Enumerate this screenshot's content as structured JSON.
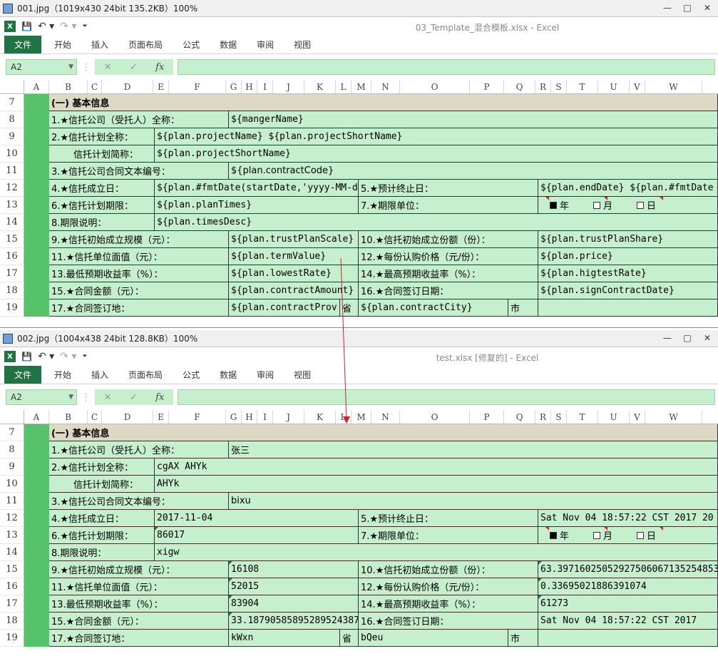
{
  "win1": {
    "viewer_title": "001.jpg（1019x430  24bit  135.2KB）100%",
    "doc_title": "03_Template_混合模板.xlsx - Excel",
    "rows": [
      {
        "rn": "7",
        "cells": [
          {
            "t": "(一) 基本信息",
            "w": 938,
            "k": "head"
          }
        ]
      },
      {
        "rn": "8",
        "cells": [
          {
            "t": "1.★信托公司（受托人）全称：",
            "w": 252,
            "k": "cn"
          },
          {
            "t": "${mangerName}",
            "w": 686
          }
        ]
      },
      {
        "rn": "9",
        "cells": [
          {
            "t": "2.★信托计划全称：",
            "w": 148,
            "k": "cn"
          },
          {
            "t": "${plan.projectName} ${plan.projectShortName}",
            "w": 790
          }
        ]
      },
      {
        "rn": "10",
        "cells": [
          {
            "t": "信托计划简称：",
            "w": 148,
            "k": "cn indent"
          },
          {
            "t": "${plan.projectShortName}",
            "w": 790
          }
        ]
      },
      {
        "rn": "11",
        "cells": [
          {
            "t": "3.★信托公司合同文本编号：",
            "w": 252,
            "k": "cn"
          },
          {
            "t": "${plan.contractCode}",
            "w": 686,
            "k": "cn"
          }
        ]
      },
      {
        "rn": "12",
        "cells": [
          {
            "t": "4.★信托成立日：",
            "w": 148,
            "k": "cn"
          },
          {
            "t": "${plan.#fmtDate(startDate,'yyyy-MM-dd')}",
            "w": 286
          },
          {
            "t": "5.★预计终止日：",
            "w": 252,
            "k": "cn"
          },
          {
            "t": "${plan.endDate} ${plan.#fmtDate",
            "w": 252
          }
        ]
      },
      {
        "rn": "13",
        "cells": [
          {
            "t": "6.★信托计划期限：",
            "w": 148,
            "k": "cn"
          },
          {
            "t": "${plan.planTimes}",
            "w": 286
          },
          {
            "t": "7.★期限单位：",
            "w": 252,
            "k": "cn"
          },
          {
            "t": "",
            "w": 252,
            "k": "units"
          }
        ]
      },
      {
        "rn": "14",
        "cells": [
          {
            "t": "8.期限说明：",
            "w": 148,
            "k": "cn"
          },
          {
            "t": "${plan.timesDesc}",
            "w": 790
          }
        ]
      },
      {
        "rn": "15",
        "cells": [
          {
            "t": "9.★信托初始成立规模（元）：",
            "w": 252,
            "k": "cn"
          },
          {
            "t": "${plan.trustPlanScale}",
            "w": 182
          },
          {
            "t": "10.★信托初始成立份额（份）：",
            "w": 252,
            "k": "cn"
          },
          {
            "t": "${plan.trustPlanShare}",
            "w": 252
          }
        ]
      },
      {
        "rn": "16",
        "cells": [
          {
            "t": "11.★信托单位面值（元）：",
            "w": 252,
            "k": "cn"
          },
          {
            "t": "${plan.termValue}",
            "w": 182
          },
          {
            "t": "12.★每份认购价格（元/份）：",
            "w": 252,
            "k": "cn"
          },
          {
            "t": "${plan.price}",
            "w": 252
          }
        ]
      },
      {
        "rn": "17",
        "cells": [
          {
            "t": "13.最低预期收益率（%）：",
            "w": 252,
            "k": "cn"
          },
          {
            "t": "${plan.lowestRate}",
            "w": 182
          },
          {
            "t": "14.★最高预期收益率（%）：",
            "w": 252,
            "k": "cn"
          },
          {
            "t": "${plan.higtestRate}",
            "w": 252
          }
        ]
      },
      {
        "rn": "18",
        "cells": [
          {
            "t": "15.★合同金额（元）：",
            "w": 252,
            "k": "cn"
          },
          {
            "t": "${plan.contractAmount}",
            "w": 182
          },
          {
            "t": "16.★合同签订日期：",
            "w": 252,
            "k": "cn"
          },
          {
            "t": "${plan.signContractDate}",
            "w": 252
          }
        ]
      },
      {
        "rn": "19",
        "cells": [
          {
            "t": "17.★合同签订地：",
            "w": 252,
            "k": "cn"
          },
          {
            "t": "${plan.contractProv",
            "w": 156
          },
          {
            "t": "省",
            "w": 26,
            "k": "cn"
          },
          {
            "t": "${plan.contractCity}",
            "w": 210
          },
          {
            "t": "市",
            "w": 42,
            "k": "cn"
          },
          {
            "t": "",
            "w": 252
          }
        ]
      }
    ]
  },
  "win2": {
    "viewer_title": "002.jpg（1004x438  24bit  128.8KB）100%",
    "doc_title": "test.xlsx [修复的] - Excel",
    "rows": [
      {
        "rn": "7",
        "cells": [
          {
            "t": "(一) 基本信息",
            "w": 938,
            "k": "head"
          }
        ]
      },
      {
        "rn": "8",
        "cells": [
          {
            "t": "1.★信托公司（受托人）全称：",
            "w": 252,
            "k": "cn"
          },
          {
            "t": "张三",
            "w": 686,
            "k": "cn"
          }
        ]
      },
      {
        "rn": "9",
        "cells": [
          {
            "t": "2.★信托计划全称：",
            "w": 148,
            "k": "cn"
          },
          {
            "t": "cgAX AHYk",
            "w": 790
          }
        ]
      },
      {
        "rn": "10",
        "cells": [
          {
            "t": "信托计划简称：",
            "w": 148,
            "k": "cn indent"
          },
          {
            "t": "AHYk",
            "w": 790
          }
        ]
      },
      {
        "rn": "11",
        "cells": [
          {
            "t": "3.★信托公司合同文本编号：",
            "w": 252,
            "k": "cn"
          },
          {
            "t": "bixu",
            "w": 686,
            "k": "cn"
          }
        ]
      },
      {
        "rn": "12",
        "cells": [
          {
            "t": "4.★信托成立日：",
            "w": 148,
            "k": "cn"
          },
          {
            "t": "2017-11-04",
            "w": 286
          },
          {
            "t": "5.★预计终止日：",
            "w": 252,
            "k": "cn"
          },
          {
            "t": "Sat Nov 04 18:57:22 CST 2017 20",
            "w": 252
          }
        ]
      },
      {
        "rn": "13",
        "cells": [
          {
            "t": "6.★信托计划期限：",
            "w": 148,
            "k": "cn"
          },
          {
            "t": "86017",
            "w": 286,
            "k": "tri"
          },
          {
            "t": "7.★期限单位：",
            "w": 252,
            "k": "cn"
          },
          {
            "t": "",
            "w": 252,
            "k": "units"
          }
        ]
      },
      {
        "rn": "14",
        "cells": [
          {
            "t": "8.期限说明：",
            "w": 148,
            "k": "cn"
          },
          {
            "t": "xigw",
            "w": 790
          }
        ]
      },
      {
        "rn": "15",
        "cells": [
          {
            "t": "9.★信托初始成立规模（元）：",
            "w": 252,
            "k": "cn"
          },
          {
            "t": "16108",
            "w": 182,
            "k": "tri"
          },
          {
            "t": "10.★信托初始成立份额（份）：",
            "w": 252,
            "k": "cn"
          },
          {
            "t": "63.39716025052927506067135254853",
            "w": 252,
            "k": "tri"
          }
        ]
      },
      {
        "rn": "16",
        "cells": [
          {
            "t": "11.★信托单位面值（元）：",
            "w": 252,
            "k": "cn"
          },
          {
            "t": "52015",
            "w": 182,
            "k": "tri"
          },
          {
            "t": "12.★每份认购价格（元/份）：",
            "w": 252,
            "k": "cn"
          },
          {
            "t": "0.33695021886391074",
            "w": 252,
            "k": "tri"
          }
        ]
      },
      {
        "rn": "17",
        "cells": [
          {
            "t": "13.最低预期收益率（%）：",
            "w": 252,
            "k": "cn"
          },
          {
            "t": "83904",
            "w": 182,
            "k": "tri"
          },
          {
            "t": "14.★最高预期收益率（%）：",
            "w": 252,
            "k": "cn"
          },
          {
            "t": "61273",
            "w": 252,
            "k": "tri"
          }
        ]
      },
      {
        "rn": "18",
        "cells": [
          {
            "t": "15.★合同金额（元）：",
            "w": 252,
            "k": "cn"
          },
          {
            "t": "33.18790585895289524387",
            "w": 182,
            "k": "tri"
          },
          {
            "t": "16.★合同签订日期：",
            "w": 252,
            "k": "cn"
          },
          {
            "t": "Sat Nov 04 18:57:22 CST 2017",
            "w": 252
          }
        ]
      },
      {
        "rn": "19",
        "cells": [
          {
            "t": "17.★合同签订地：",
            "w": 252,
            "k": "cn"
          },
          {
            "t": "kWxn",
            "w": 156
          },
          {
            "t": "省",
            "w": 26,
            "k": "cn"
          },
          {
            "t": "bQeu",
            "w": 210
          },
          {
            "t": "市",
            "w": 42,
            "k": "cn"
          },
          {
            "t": "",
            "w": 252
          }
        ]
      }
    ]
  },
  "ribbon_tabs": [
    "文件",
    "开始",
    "插入",
    "页面布局",
    "公式",
    "数据",
    "审阅",
    "视图"
  ],
  "name_box": "A2",
  "fx_label": "fx",
  "columns": [
    "A",
    "B",
    "C",
    "D",
    "E",
    "F",
    "G",
    "H",
    "I",
    "J",
    "K",
    "L",
    "M",
    "N",
    "O",
    "P",
    "Q",
    "R",
    "S",
    "T",
    "U",
    "V",
    "W"
  ],
  "units": {
    "year": "年",
    "month": "月",
    "day": "日"
  },
  "icons": {
    "excel": "excel-logo-icon",
    "save": "save-icon",
    "undo": "undo-icon",
    "redo": "redo-icon",
    "customize": "qat-customize-icon",
    "cancel": "cancel-icon",
    "enter": "enter-icon",
    "function": "fx-icon"
  },
  "colors": {
    "excel_green": "#217346",
    "cell_fill": "#c6efce",
    "header_fill": "#ddd9c4",
    "column_a_fill": "#56c26a",
    "arrow": "#d22222"
  }
}
